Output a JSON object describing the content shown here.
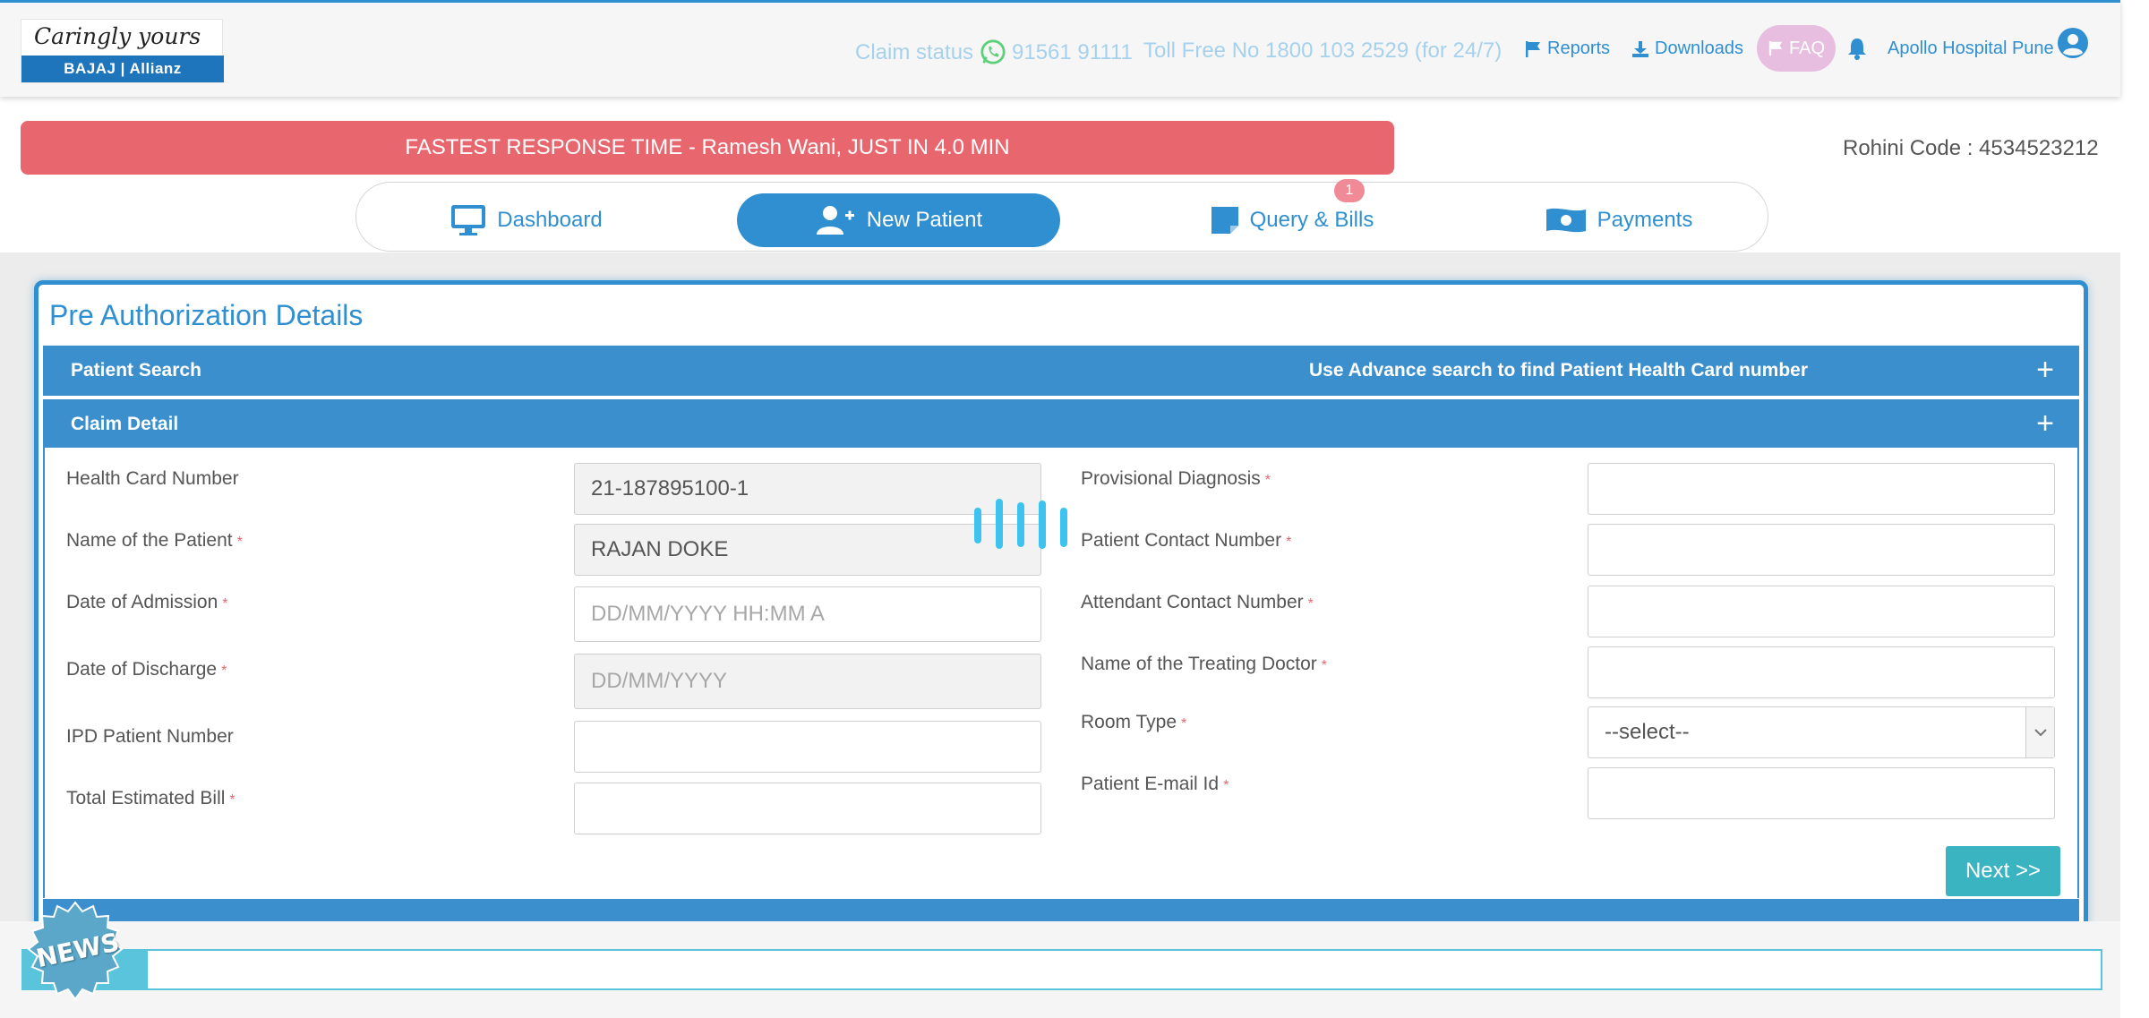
{
  "header": {
    "logo_tagline": "Caringly yours",
    "logo_brand": "BAJAJ | Allianz",
    "claim_status_label": "Claim status",
    "claim_phone": "91561 91111",
    "toll_free": "Toll Free No 1800 103 2529 (for 24/7)",
    "reports": "Reports",
    "downloads": "Downloads",
    "faq": "FAQ",
    "user_name": "Apollo Hospital Pune"
  },
  "notice": "FASTEST RESPONSE TIME - Ramesh Wani, JUST IN 4.0 MIN",
  "rohini": "Rohini Code : 4534523212",
  "nav": {
    "tabs": [
      {
        "label": "Dashboard"
      },
      {
        "label": "New Patient"
      },
      {
        "label": "Query & Bills"
      },
      {
        "label": "Payments"
      }
    ],
    "query_badge": "1"
  },
  "panel": {
    "title": "Pre Authorization Details",
    "patient_search": {
      "label": "Patient Search",
      "hint": "Use Advance search to find Patient Health Card number"
    },
    "claim_detail": {
      "label": "Claim Detail"
    },
    "left_fields": [
      {
        "label": "Health Card Number",
        "value": "21-187895100-1"
      },
      {
        "label": "Name of the Patient",
        "value": "RAJAN DOKE"
      },
      {
        "label": "Date of Admission",
        "placeholder": "DD/MM/YYYY HH:MM A"
      },
      {
        "label": "Date of Discharge",
        "placeholder": "DD/MM/YYYY"
      },
      {
        "label": "IPD Patient Number",
        "value": ""
      },
      {
        "label": "Total Estimated Bill",
        "value": ""
      }
    ],
    "right_fields": [
      {
        "label": "Provisional Diagnosis",
        "value": ""
      },
      {
        "label": "Patient Contact Number",
        "value": ""
      },
      {
        "label": "Attendant Contact Number",
        "value": ""
      },
      {
        "label": "Name of the Treating Doctor",
        "value": ""
      },
      {
        "label": "Room Type",
        "value": "--select--"
      },
      {
        "label": "Patient E-mail Id",
        "value": ""
      }
    ],
    "required_mark": "*",
    "next_button": "Next >>"
  },
  "footer": {
    "news_badge": "NEWS"
  },
  "colors": {
    "primary": "#2f8fd0",
    "accordion": "#3c8fcd",
    "notice": "#e8676f",
    "next_button": "#3bb4c1",
    "faq": "#e7bde0"
  },
  "icons": [
    "whatsapp-icon",
    "flag-icon",
    "download-icon",
    "bell-icon",
    "user-icon",
    "monitor-icon",
    "add-user-icon",
    "bill-icon",
    "payment-icon",
    "loading-icon"
  ]
}
